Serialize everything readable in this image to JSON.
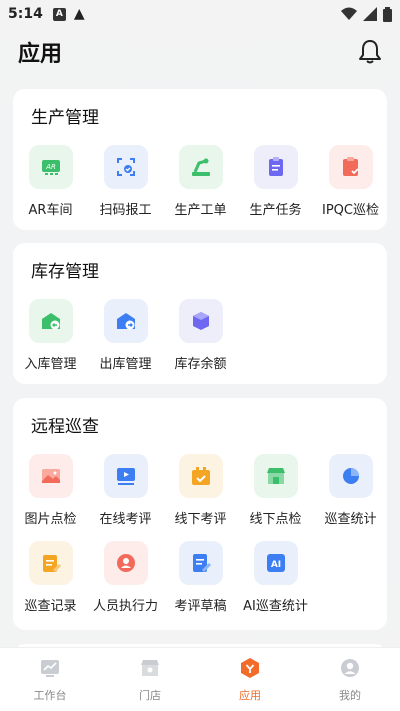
{
  "status": {
    "time": "5:14"
  },
  "header": {
    "title": "应用"
  },
  "sections": [
    {
      "title": "生产管理",
      "items": [
        {
          "label": "AR车间",
          "icon": "ar-icon",
          "bg": "#e8f6ec",
          "fg": "#3bbf6a"
        },
        {
          "label": "扫码报工",
          "icon": "scan-icon",
          "bg": "#eaf0fb",
          "fg": "#3d7ff2"
        },
        {
          "label": "生产工单",
          "icon": "robot-arm-icon",
          "bg": "#e8f6ec",
          "fg": "#3bbf6a"
        },
        {
          "label": "生产任务",
          "icon": "clipboard-icon",
          "bg": "#eeeefb",
          "fg": "#6d67f2"
        },
        {
          "label": "IPQC巡检",
          "icon": "inspect-icon",
          "bg": "#fdecea",
          "fg": "#f26a5a"
        }
      ]
    },
    {
      "title": "库存管理",
      "items": [
        {
          "label": "入库管理",
          "icon": "inbound-icon",
          "bg": "#e8f6ec",
          "fg": "#3bbf6a"
        },
        {
          "label": "出库管理",
          "icon": "outbound-icon",
          "bg": "#eaf0fb",
          "fg": "#3d7ff2"
        },
        {
          "label": "库存余额",
          "icon": "stock-icon",
          "bg": "#eeeefb",
          "fg": "#6d67f2"
        }
      ]
    },
    {
      "title": "远程巡查",
      "items": [
        {
          "label": "图片点检",
          "icon": "image-icon",
          "bg": "#fdecea",
          "fg": "#f26a5a"
        },
        {
          "label": "在线考评",
          "icon": "video-icon",
          "bg": "#eaf0fb",
          "fg": "#3d7ff2"
        },
        {
          "label": "线下考评",
          "icon": "check-box-icon",
          "bg": "#fdf3e2",
          "fg": "#f5a524"
        },
        {
          "label": "线下点检",
          "icon": "store-icon",
          "bg": "#e8f6ec",
          "fg": "#3bbf6a"
        },
        {
          "label": "巡查统计",
          "icon": "pie-icon",
          "bg": "#eaf0fb",
          "fg": "#3d7ff2"
        },
        {
          "label": "巡查记录",
          "icon": "record-icon",
          "bg": "#fdf3e2",
          "fg": "#f5a524"
        },
        {
          "label": "人员执行力",
          "icon": "person-icon",
          "bg": "#fdecea",
          "fg": "#f26a5a"
        },
        {
          "label": "考评草稿",
          "icon": "draft-icon",
          "bg": "#eaf0fb",
          "fg": "#3d7ff2"
        },
        {
          "label": "AI巡查统计",
          "icon": "ai-icon",
          "bg": "#eaf0fb",
          "fg": "#3d7ff2",
          "text": "AI"
        }
      ]
    }
  ],
  "nav": [
    {
      "label": "工作台",
      "icon": "workbench-icon",
      "active": false
    },
    {
      "label": "门店",
      "icon": "store-nav-icon",
      "active": false
    },
    {
      "label": "应用",
      "icon": "app-icon",
      "active": true
    },
    {
      "label": "我的",
      "icon": "profile-icon",
      "active": false
    }
  ],
  "colors": {
    "accent": "#f26b2a"
  }
}
